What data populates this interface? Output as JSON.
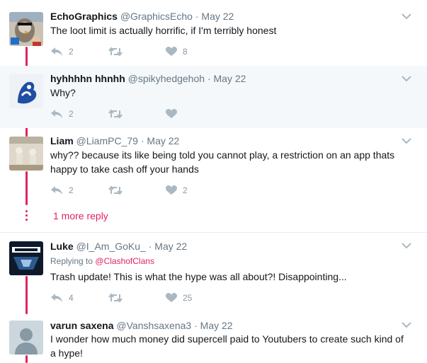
{
  "tweets": [
    {
      "name": "EchoGraphics",
      "handle": "@GraphicsEcho",
      "dot": "·",
      "date": "May 22",
      "text": "The loot limit is actually horrific, if I'm terribly honest",
      "replies": "2",
      "retweets": "",
      "likes": "8",
      "avatar": "bird-mascot-avatar"
    },
    {
      "name": "hyhhhhn hhnhh",
      "handle": "@spikyhedgehoh",
      "dot": "·",
      "date": "May 22",
      "text": "Why?",
      "replies": "2",
      "retweets": "",
      "likes": "",
      "avatar": "chelsea-lion-avatar"
    },
    {
      "name": "Liam",
      "handle": "@LiamPC_79",
      "dot": "·",
      "date": "May 22",
      "text": "why?? because its like being told you cannot play, a restriction on an app thats happy to take cash off your hands",
      "replies": "2",
      "retweets": "",
      "likes": "2",
      "avatar": "figures-avatar"
    },
    {
      "name": "Luke",
      "handle": "@I_Am_GoKu_",
      "dot": "·",
      "date": "May 22",
      "reply_prefix": "Replying to",
      "reply_user": "@ClashofClans",
      "text": "Trash update! This is what the hype was all about?! Disappointing...",
      "replies": "4",
      "retweets": "",
      "likes": "25",
      "avatar": "call-of-duty-avatar"
    },
    {
      "name": "varun saxena",
      "handle": "@Vanshsaxena3",
      "dot": "·",
      "date": "May 22",
      "text": "I wonder how much money did supercell paid to Youtubers to create such kind of a hype!",
      "avatar": "default-avatar"
    }
  ],
  "more_replies": "1 more reply",
  "colors": {
    "accent": "#e0245e",
    "muted": "#657786",
    "icon": "#aab8c2",
    "highlight_bg": "#f5f8fa"
  }
}
